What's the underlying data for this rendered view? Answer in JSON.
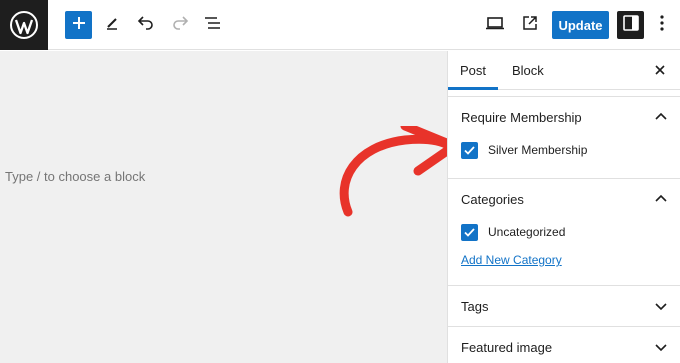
{
  "toolbar": {
    "add_block_icon": "plus-icon",
    "tools_icon": "pencil-icon",
    "undo_icon": "undo-icon",
    "redo_icon": "redo-icon",
    "list_view_icon": "list-view-icon",
    "preview_icon": "desktop-icon",
    "view_post_icon": "external-link-icon",
    "update_label": "Update",
    "settings_icon": "sidebar-icon",
    "options_icon": "more-vertical-icon"
  },
  "editor": {
    "placeholder": "Type / to choose a block"
  },
  "sidebar": {
    "tabs": [
      {
        "label": "Post",
        "active": true
      },
      {
        "label": "Block",
        "active": false
      }
    ],
    "panels": {
      "membership": {
        "title": "Require Membership",
        "option_label": "Silver Membership",
        "checked": true
      },
      "categories": {
        "title": "Categories",
        "option_label": "Uncategorized",
        "checked": true,
        "add_link": "Add New Category"
      },
      "tags": {
        "title": "Tags"
      },
      "featured": {
        "title": "Featured image"
      }
    }
  },
  "colors": {
    "accent": "#1273c7",
    "arrow": "#e8332a",
    "dark": "#1e1e1e",
    "canvas": "#f0f0f0"
  }
}
